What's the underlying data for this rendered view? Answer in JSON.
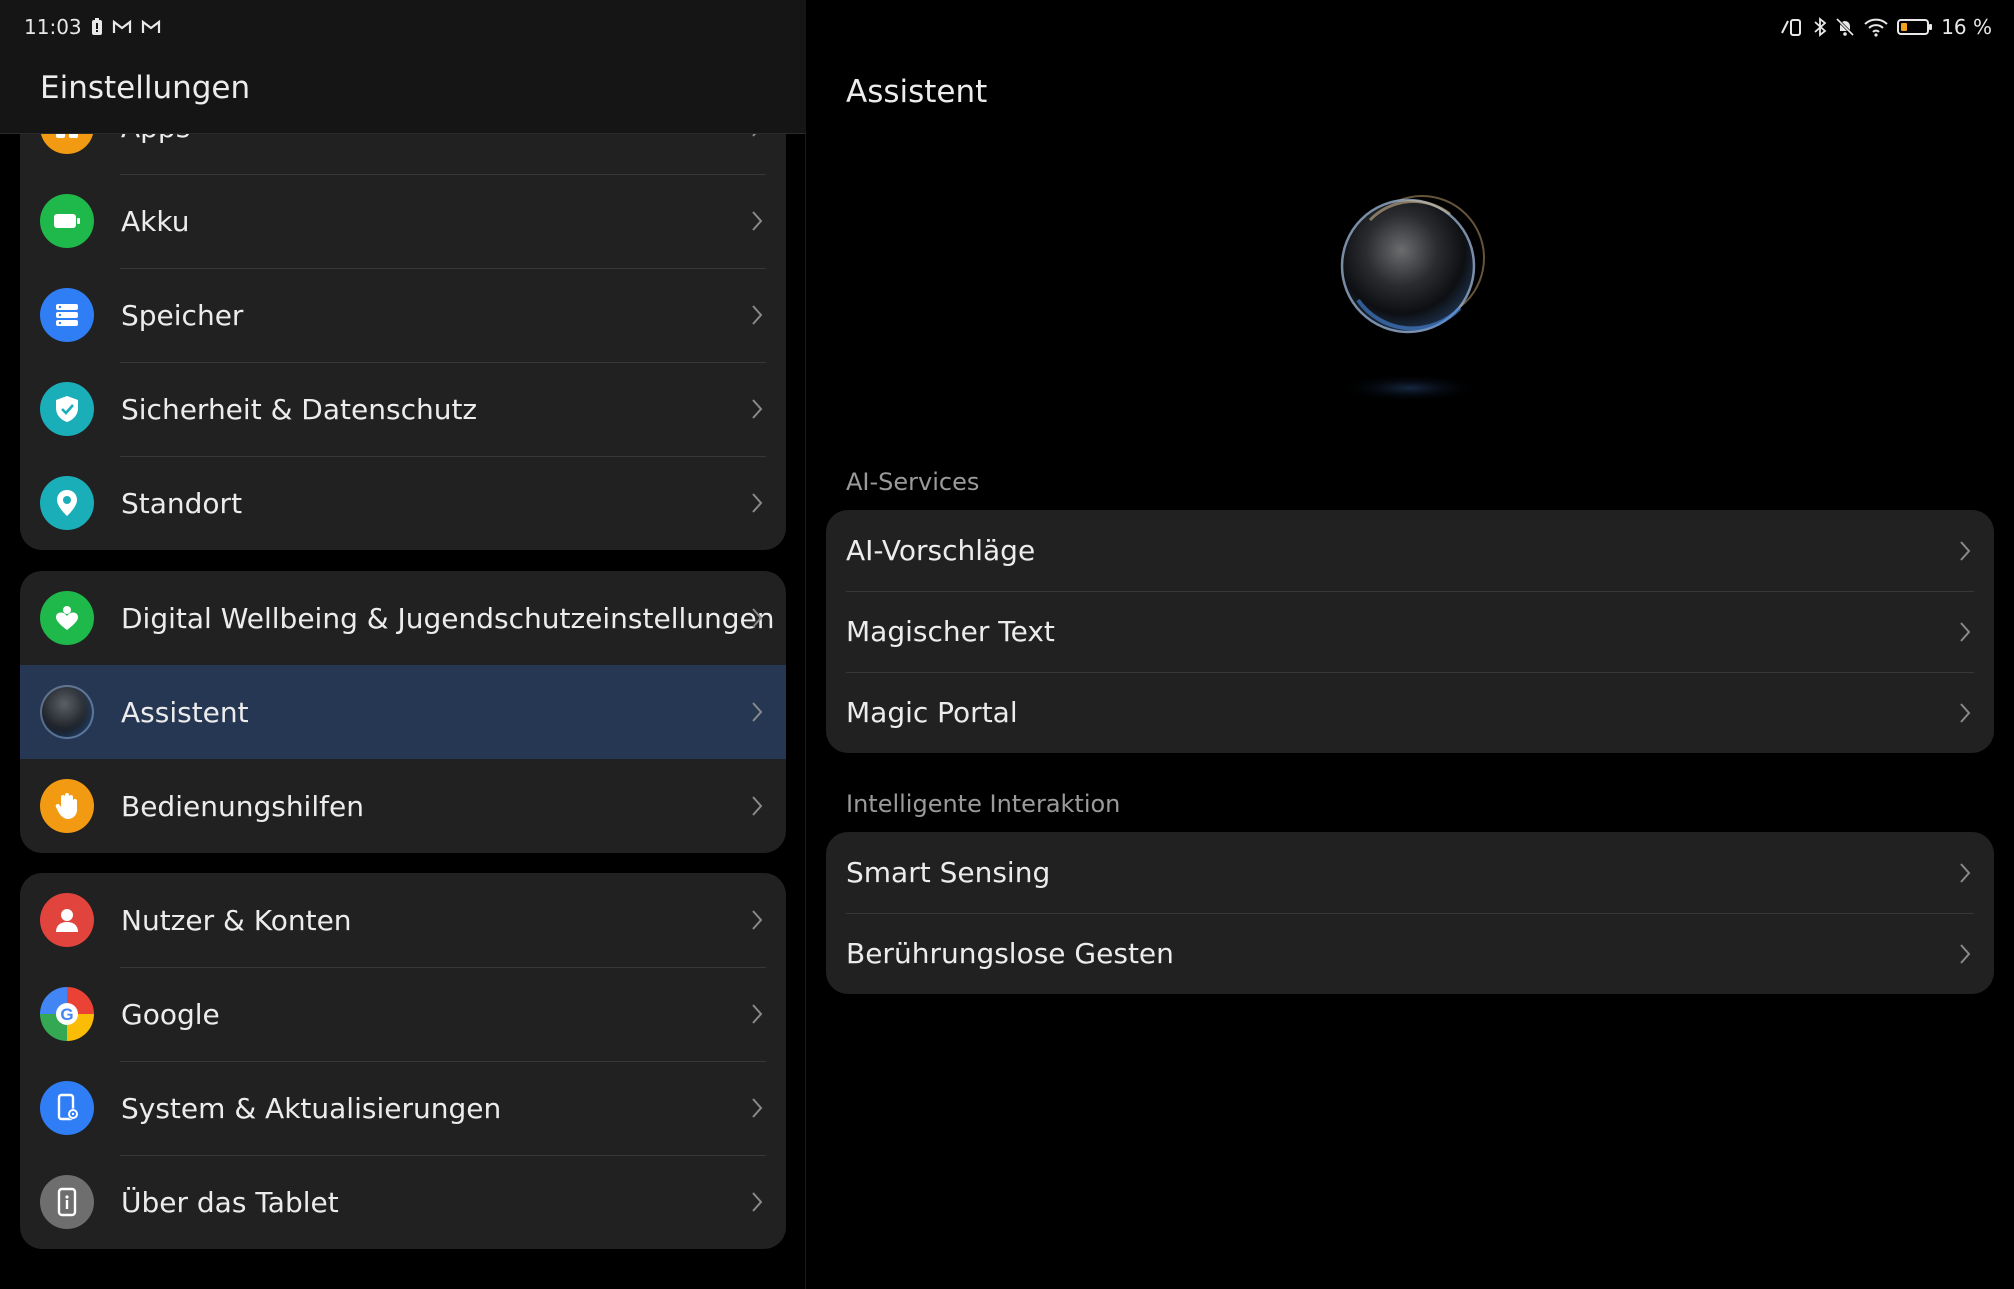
{
  "status_bar": {
    "time": "11:03",
    "battery_percent": "16 %"
  },
  "left": {
    "title": "Einstellungen",
    "partial_item": "Apps",
    "group1": [
      {
        "label": "Akku",
        "icon": "battery-icon",
        "color": "#1fb84a"
      },
      {
        "label": "Speicher",
        "icon": "storage-icon",
        "color": "#2f7ef5"
      },
      {
        "label": "Sicherheit & Datenschutz",
        "icon": "shield-icon",
        "color": "#1aaeb8"
      },
      {
        "label": "Standort",
        "icon": "location-pin-icon",
        "color": "#1aaeb8"
      }
    ],
    "group2": [
      {
        "label": "Digital Wellbeing & Jugendschutzeinstellungen",
        "icon": "wellbeing-heart-icon",
        "color": "#1fb84a"
      },
      {
        "label": "Assistent",
        "icon": "assistant-orb-icon",
        "color": "#3a4a66",
        "selected": true
      },
      {
        "label": "Bedienungshilfen",
        "icon": "hand-icon",
        "color": "#f29a12"
      }
    ],
    "group3": [
      {
        "label": "Nutzer & Konten",
        "icon": "person-icon",
        "color": "#e0443d"
      },
      {
        "label": "Google",
        "icon": "google-g-icon",
        "color": "#ffffff"
      },
      {
        "label": "System & Aktualisierungen",
        "icon": "system-update-icon",
        "color": "#2f7ef5"
      },
      {
        "label": "Über das Tablet",
        "icon": "info-device-icon",
        "color": "#6e6e6e"
      }
    ]
  },
  "right": {
    "title": "Assistent",
    "section1_title": "AI-Services",
    "section1_items": [
      "AI-Vorschläge",
      "Magischer Text",
      "Magic Portal"
    ],
    "section2_title": "Intelligente Interaktion",
    "section2_items": [
      "Smart Sensing",
      "Berührungslose Gesten"
    ]
  }
}
